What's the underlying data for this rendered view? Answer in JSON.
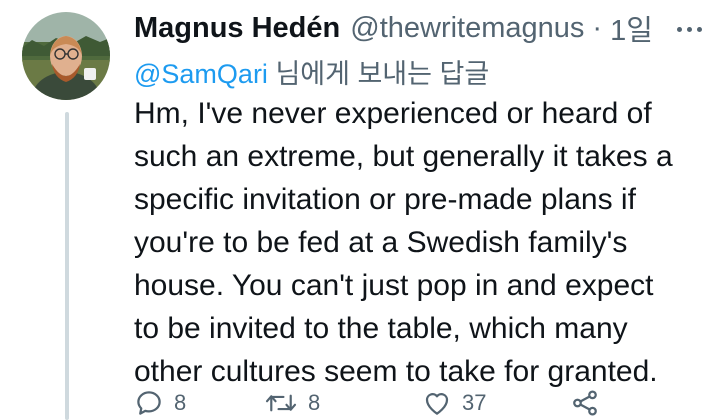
{
  "tweet": {
    "display_name": "Magnus Hedén",
    "handle": "@thewritemagnus",
    "separator": "·",
    "timestamp": "1일",
    "reply_to": {
      "mention": "@SamQari",
      "suffix": " 님에게 보내는 답글"
    },
    "text_lines": [
      "Hm, I've never experienced or heard of",
      "such an extreme, but generally it takes a",
      "specific invitation or pre-made plans if",
      "you're to be fed at a Swedish family's",
      "house. You can't just pop in and expect",
      "to be invited to the table, which many",
      "other cultures seem to take for granted."
    ],
    "actions": {
      "reply_count": "8",
      "retweet_count": "8",
      "like_count": "37"
    },
    "icons": {
      "reply": "reply-icon",
      "retweet": "retweet-icon",
      "like": "heart-icon",
      "share": "share-icon",
      "more": "more-icon"
    },
    "colors": {
      "text": "#0f1419",
      "secondary": "#536471",
      "link": "#1d9bf0",
      "thread_line": "#cfd9de"
    }
  }
}
